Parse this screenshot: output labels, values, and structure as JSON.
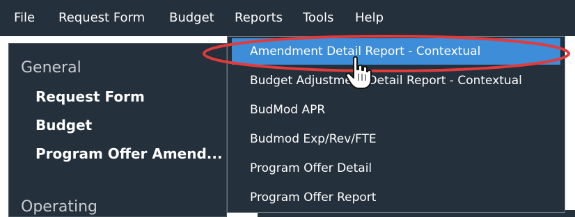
{
  "menubar": {
    "items": [
      "File",
      "Request Form",
      "Budget",
      "Reports",
      "Tools",
      "Help"
    ]
  },
  "sidebar": {
    "general_heading": "General",
    "items": [
      "Request Form",
      "Budget",
      "Program Offer Amend..."
    ],
    "operating_heading": "Operating"
  },
  "reports_menu": {
    "items": [
      "Amendment Detail Report - Contextual",
      "Budget Adjustment Detail Report - Contextual",
      "BudMod APR",
      "Budmod Exp/Rev/FTE",
      "Program Offer Detail",
      "Program Offer Report"
    ],
    "highlighted_index": 0
  },
  "colors": {
    "menubar_bg": "#24303c",
    "highlight": "#3d8dd8",
    "annotation": "#e23b3b"
  },
  "cursor": "hand-pointer-icon"
}
